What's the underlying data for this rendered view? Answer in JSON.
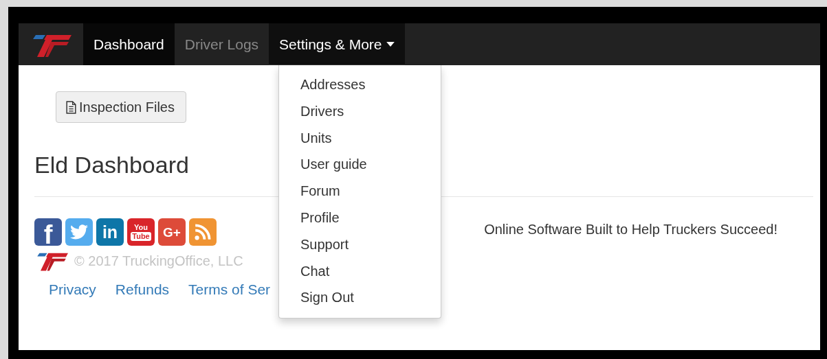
{
  "navbar": {
    "items": [
      {
        "label": "Dashboard",
        "selected": true,
        "expanded": false,
        "dropdown": false
      },
      {
        "label": "Driver Logs",
        "selected": false,
        "expanded": false,
        "dropdown": false
      },
      {
        "label": "Settings & More",
        "selected": false,
        "expanded": true,
        "dropdown": true
      }
    ]
  },
  "dropdown_menu": {
    "items": [
      "Addresses",
      "Drivers",
      "Units",
      "User guide",
      "Forum",
      "Profile",
      "Support",
      "Chat",
      "Sign Out"
    ]
  },
  "toolbar": {
    "button": "Inspection Files"
  },
  "heading": "Eld Dashboard",
  "footer": {
    "social": [
      {
        "kind": "facebook",
        "color": "#3b5998",
        "lines": [
          "f"
        ]
      },
      {
        "kind": "twitter",
        "color": "#55acee"
      },
      {
        "kind": "linkedin",
        "color": "#0e76a8",
        "lines": [
          "in"
        ]
      },
      {
        "kind": "youtube",
        "color": "#d9252a",
        "lines": [
          "You",
          "Tube"
        ]
      },
      {
        "kind": "googleplus",
        "color": "#dd4b39",
        "lines": [
          "G+"
        ]
      },
      {
        "kind": "rss",
        "color": "#f09433"
      }
    ],
    "copyright": "© 2017 TruckingOffice, LLC",
    "links": [
      "Privacy",
      "Refunds",
      "Terms of Ser"
    ],
    "tagline": "Online Software Built to Help Truckers Succeed!"
  }
}
